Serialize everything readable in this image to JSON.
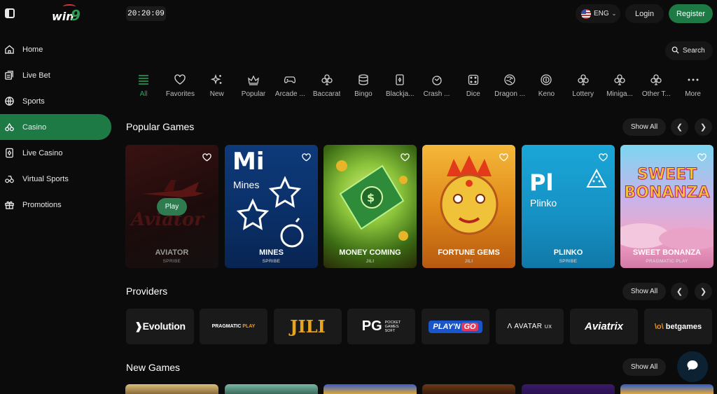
{
  "header": {
    "logo_text": "win",
    "logo_nine": "9",
    "clock": "20:20:09",
    "language": "ENG",
    "login_label": "Login",
    "register_label": "Register",
    "search_label": "Search"
  },
  "sidebar": {
    "items": [
      {
        "label": "Home",
        "icon": "home-icon"
      },
      {
        "label": "Live Bet",
        "icon": "live-bet-icon"
      },
      {
        "label": "Sports",
        "icon": "sports-icon"
      },
      {
        "label": "Casino",
        "icon": "casino-icon",
        "active": true
      },
      {
        "label": "Live Casino",
        "icon": "live-casino-icon"
      },
      {
        "label": "Virtual Sports",
        "icon": "virtual-sports-icon"
      },
      {
        "label": "Promotions",
        "icon": "gift-icon"
      }
    ]
  },
  "categories": [
    {
      "label": "All",
      "icon": "list-icon",
      "active": true
    },
    {
      "label": "Favorites",
      "icon": "heart-icon"
    },
    {
      "label": "New",
      "icon": "sparkle-icon"
    },
    {
      "label": "Popular",
      "icon": "crown-icon"
    },
    {
      "label": "Arcade ...",
      "icon": "gamepad-icon"
    },
    {
      "label": "Baccarat",
      "icon": "club-icon"
    },
    {
      "label": "Bingo",
      "icon": "bingo-icon"
    },
    {
      "label": "Blackja...",
      "icon": "card-icon"
    },
    {
      "label": "Crash ...",
      "icon": "crash-icon"
    },
    {
      "label": "Dice",
      "icon": "dice-icon"
    },
    {
      "label": "Dragon ...",
      "icon": "dragon-icon"
    },
    {
      "label": "Keno",
      "icon": "keno-icon"
    },
    {
      "label": "Lottery",
      "icon": "club-icon"
    },
    {
      "label": "Miniga...",
      "icon": "club-icon"
    },
    {
      "label": "Other T...",
      "icon": "club-icon"
    },
    {
      "label": "More",
      "icon": "more-icon"
    }
  ],
  "sections": {
    "popular_title": "Popular Games",
    "providers_title": "Providers",
    "new_title": "New Games",
    "show_all": "Show All"
  },
  "popular_games": [
    {
      "name": "AVIATOR",
      "provider": "SPRIBE",
      "play_label": "Play",
      "logo_text": "Aviator"
    },
    {
      "name": "MINES",
      "provider": "SPRIBE",
      "big": "Mi",
      "sub": "Mines"
    },
    {
      "name": "MONEY COMING",
      "provider": "JILI"
    },
    {
      "name": "FORTUNE GEMS",
      "provider": "JILI"
    },
    {
      "name": "PLINKO",
      "provider": "SPRIBE",
      "big": "Pl",
      "sub": "Plinko"
    },
    {
      "name": "SWEET BONANZA",
      "provider": "PRAGMATIC PLAY",
      "logo_line1": "SWEET",
      "logo_line2": "BONANZA"
    }
  ],
  "providers": [
    {
      "name": "Evolution"
    },
    {
      "name": "PRAGMATIC PLAY",
      "word1": "PRAGMATIC",
      "word2": "PLAY"
    },
    {
      "name": "JILI"
    },
    {
      "name": "PG SOFT",
      "mark": "PG",
      "line1": "POCKET",
      "line2": "GAMES",
      "line3": "SOFT"
    },
    {
      "name": "PLAY'N GO",
      "word1": "PLAY'N",
      "word2": "GO"
    },
    {
      "name": "AVATAR UX",
      "word1": "AVATAR",
      "word2": "UX"
    },
    {
      "name": "Aviatrix"
    },
    {
      "name": "betgames",
      "mark": "\\o\\"
    }
  ],
  "colors": {
    "accent": "#1e7a45",
    "background": "#0b0b0b",
    "surface": "#1b1b1b"
  }
}
